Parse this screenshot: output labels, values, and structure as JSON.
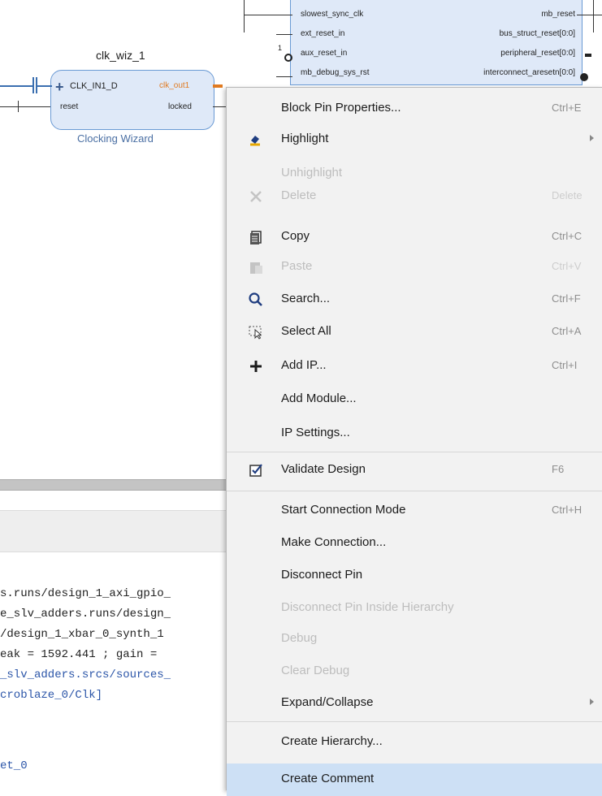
{
  "diagram": {
    "block_title": "clk_wiz_1",
    "block_subtitle": "Clocking Wizard",
    "block_in_port": "CLK_IN1_D",
    "block_reset_port": "reset",
    "block_out_port": "clk_out1",
    "block_locked_port": "locked",
    "reset_block": {
      "inputs": [
        "slowest_sync_clk",
        "ext_reset_in",
        "aux_reset_in",
        "mb_debug_sys_rst"
      ],
      "outputs": [
        "mb_reset",
        "bus_struct_reset[0:0]",
        "peripheral_reset[0:0]",
        "interconnect_aresetn[0:0]"
      ],
      "marker": "1"
    },
    "colors": {
      "block_border": "#6a9ad4",
      "block_fill": "#dfe9f8",
      "out_port": "#e07a20",
      "subtitle": "#4a6fa3"
    }
  },
  "console": {
    "lines": [
      {
        "text": "s.runs/design_1_axi_gpio_",
        "link": false
      },
      {
        "text": "e_slv_adders.runs/design_",
        "link": false
      },
      {
        "text": "/design_1_xbar_0_synth_1",
        "link": false
      },
      {
        "text": "eak = 1592.441 ; gain =",
        "link": false
      },
      {
        "text": "_slv_adders.srcs/sources_",
        "link": true
      },
      {
        "text": "croblaze_0/Clk]",
        "link": true
      },
      {
        "text": "",
        "link": false
      },
      {
        "text": "et_0",
        "link": true
      }
    ]
  },
  "menu": {
    "items": [
      {
        "label": "Block Pin Properties...",
        "shortcut": "Ctrl+E",
        "icon": "",
        "disabled": false,
        "submenu": false
      },
      {
        "label": "Highlight",
        "shortcut": "",
        "icon": "highlight-icon",
        "disabled": false,
        "submenu": true
      },
      {
        "label": "Unhighlight",
        "shortcut": "",
        "icon": "",
        "disabled": true,
        "submenu": false
      },
      {
        "label": "Delete",
        "shortcut": "Delete",
        "icon": "delete-icon",
        "disabled": true,
        "submenu": false
      },
      {
        "label": "Copy",
        "shortcut": "Ctrl+C",
        "icon": "copy-icon",
        "disabled": false,
        "submenu": false
      },
      {
        "label": "Paste",
        "shortcut": "Ctrl+V",
        "icon": "paste-icon",
        "disabled": true,
        "submenu": false
      },
      {
        "label": "Search...",
        "shortcut": "Ctrl+F",
        "icon": "search-icon",
        "disabled": false,
        "submenu": false
      },
      {
        "label": "Select All",
        "shortcut": "Ctrl+A",
        "icon": "select-all-icon",
        "disabled": false,
        "submenu": false
      },
      {
        "label": "Add IP...",
        "shortcut": "Ctrl+I",
        "icon": "add-icon",
        "disabled": false,
        "submenu": false
      },
      {
        "label": "Add Module...",
        "shortcut": "",
        "icon": "",
        "disabled": false,
        "submenu": false
      },
      {
        "label": "IP Settings...",
        "shortcut": "",
        "icon": "",
        "disabled": false,
        "submenu": false
      },
      {
        "label": "Validate Design",
        "shortcut": "F6",
        "icon": "validate-icon",
        "disabled": false,
        "submenu": false
      },
      {
        "label": "Start Connection Mode",
        "shortcut": "Ctrl+H",
        "icon": "",
        "disabled": false,
        "submenu": false
      },
      {
        "label": "Make Connection...",
        "shortcut": "",
        "icon": "",
        "disabled": false,
        "submenu": false
      },
      {
        "label": "Disconnect Pin",
        "shortcut": "",
        "icon": "",
        "disabled": false,
        "submenu": false
      },
      {
        "label": "Disconnect Pin Inside Hierarchy",
        "shortcut": "",
        "icon": "",
        "disabled": true,
        "submenu": false
      },
      {
        "label": "Debug",
        "shortcut": "",
        "icon": "",
        "disabled": true,
        "submenu": false
      },
      {
        "label": "Clear Debug",
        "shortcut": "",
        "icon": "",
        "disabled": true,
        "submenu": false
      },
      {
        "label": "Expand/Collapse",
        "shortcut": "",
        "icon": "",
        "disabled": false,
        "submenu": true
      },
      {
        "label": "Create Hierarchy...",
        "shortcut": "",
        "icon": "",
        "disabled": false,
        "submenu": false
      },
      {
        "label": "Create Comment",
        "shortcut": "",
        "icon": "",
        "disabled": false,
        "submenu": false,
        "highlighted": true
      }
    ]
  }
}
